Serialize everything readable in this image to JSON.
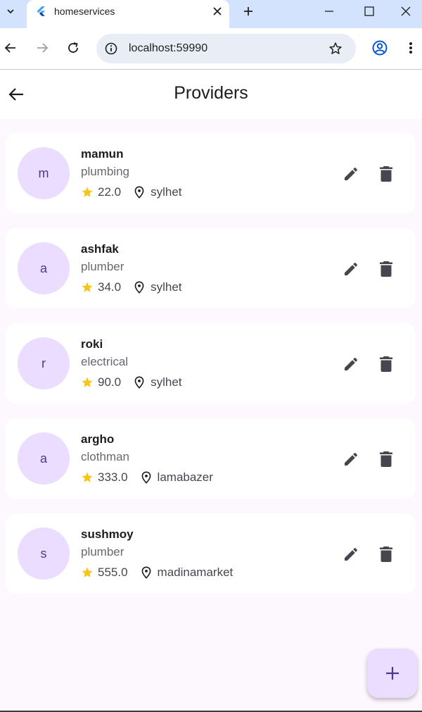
{
  "browser": {
    "tab_title": "homeservices",
    "url": "localhost:59990"
  },
  "appbar": {
    "title": "Providers"
  },
  "providers": [
    {
      "initial": "m",
      "name": "mamun",
      "service": "plumbing",
      "rating": "22.0",
      "location": "sylhet"
    },
    {
      "initial": "a",
      "name": "ashfak",
      "service": "plumber",
      "rating": "34.0",
      "location": "sylhet"
    },
    {
      "initial": "r",
      "name": "roki",
      "service": "electrical",
      "rating": "90.0",
      "location": "sylhet"
    },
    {
      "initial": "a",
      "name": "argho",
      "service": "clothman",
      "rating": "333.0",
      "location": "lamabazer"
    },
    {
      "initial": "s",
      "name": "sushmoy",
      "service": "plumber",
      "rating": "555.0",
      "location": "madinamarket"
    }
  ],
  "icons": {
    "back": "arrow-left-icon",
    "edit": "pencil-icon",
    "delete": "trash-icon",
    "rating": "star-icon",
    "location": "location-pin-icon",
    "add": "plus-icon"
  },
  "colors": {
    "avatar_bg": "#eaddff",
    "avatar_text": "#4f378b",
    "star": "#f5c518",
    "page_bg": "#fdf7fe",
    "fab_bg": "#eaddff"
  }
}
